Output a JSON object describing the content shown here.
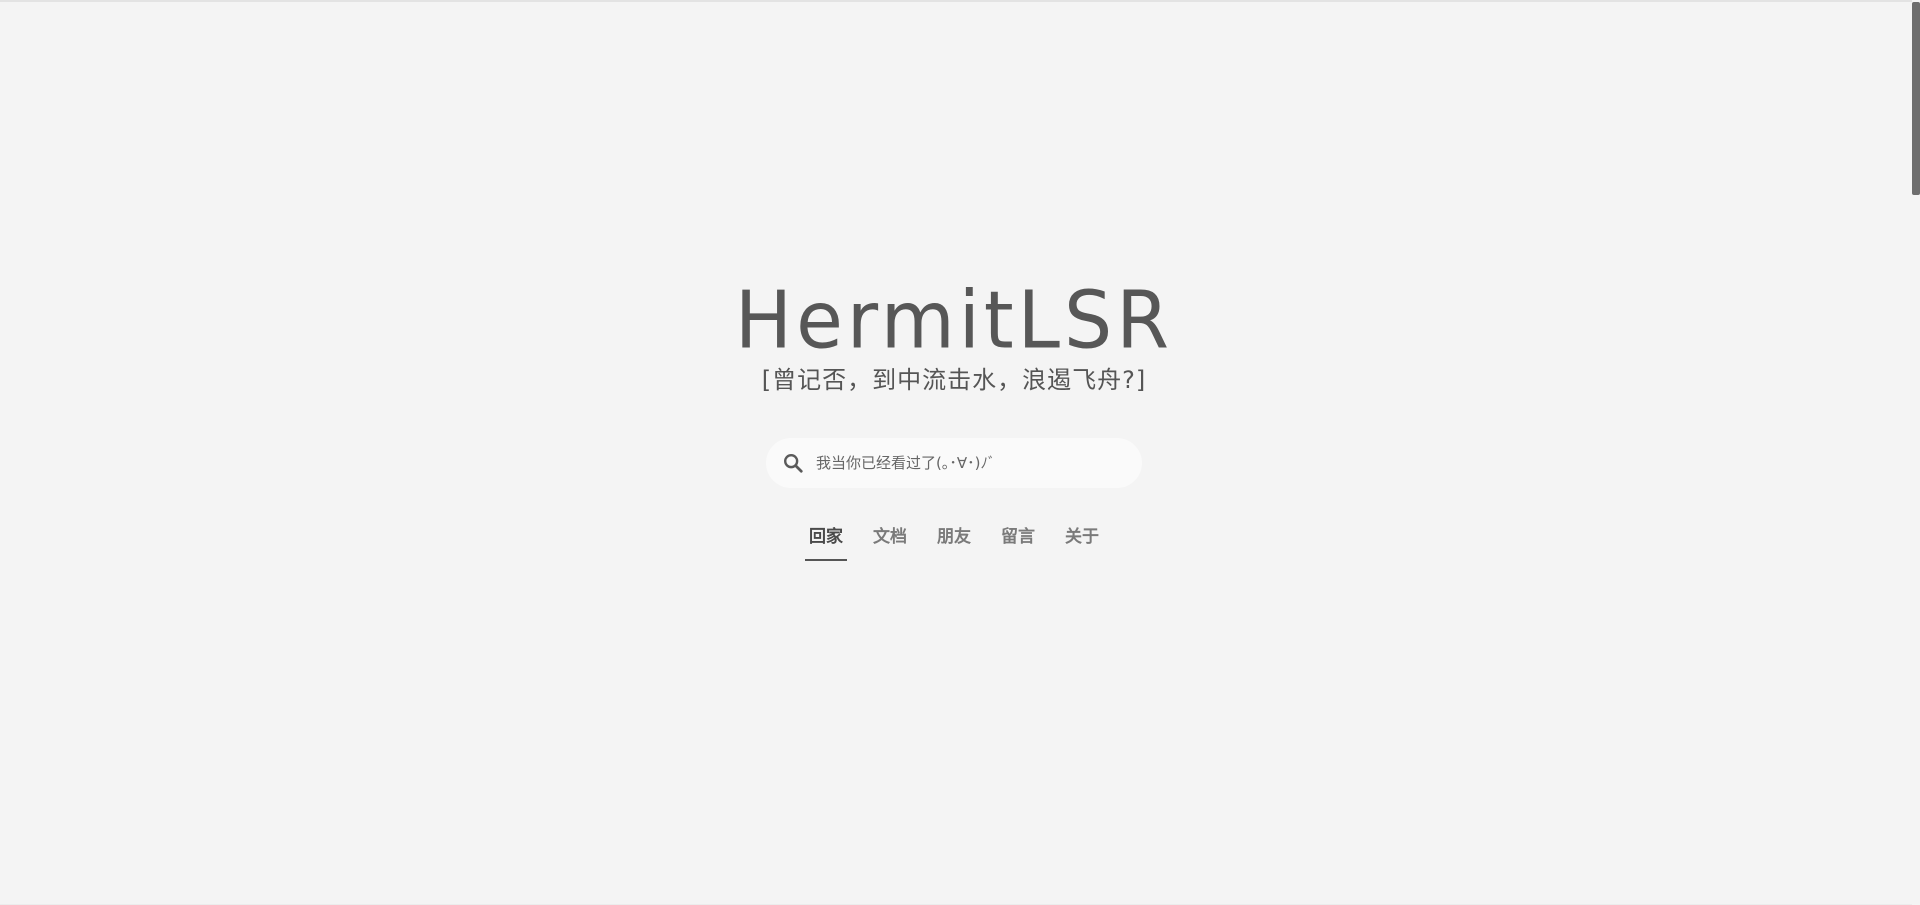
{
  "site": {
    "title": "HermitLSR",
    "subtitle": "[曾记否，到中流击水，浪遏飞舟?]"
  },
  "search": {
    "icon": "search-icon",
    "placeholder": "我当你已经看过了(｡･∀･)ﾉﾞ"
  },
  "nav": {
    "items": [
      {
        "label": "回家",
        "active": true
      },
      {
        "label": "文档",
        "active": false
      },
      {
        "label": "朋友",
        "active": false
      },
      {
        "label": "留言",
        "active": false
      },
      {
        "label": "关于",
        "active": false
      }
    ]
  },
  "colors": {
    "background": "#f4f4f4",
    "text": "#575757",
    "search_bg": "#fafafa",
    "scrollbar_thumb": "#6e6e6e"
  }
}
